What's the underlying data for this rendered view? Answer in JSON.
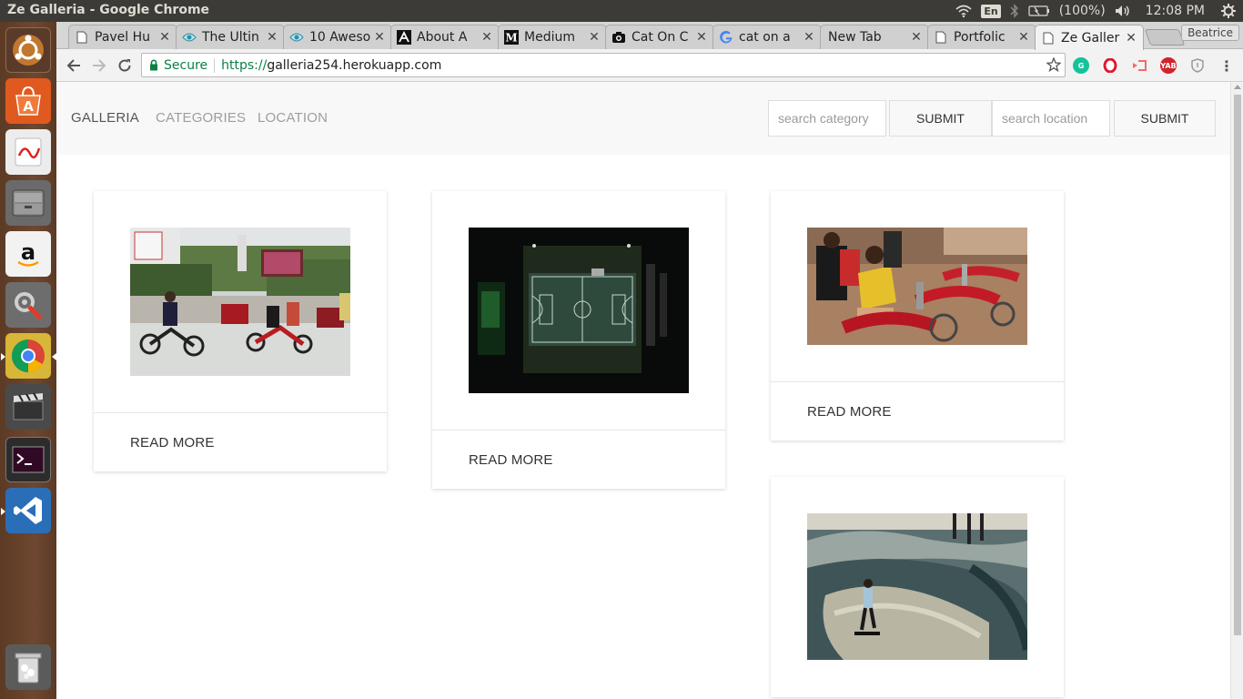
{
  "os": {
    "window_title": "Ze Galleria - Google Chrome",
    "keyboard_layout": "En",
    "battery": "(100%)",
    "clock": "12:08 PM"
  },
  "launcher": {
    "items": [
      {
        "name": "ubuntu-dash-icon"
      },
      {
        "name": "software-center-icon"
      },
      {
        "name": "document-viewer-icon"
      },
      {
        "name": "file-manager-icon"
      },
      {
        "name": "amazon-icon"
      },
      {
        "name": "system-settings-icon"
      },
      {
        "name": "chrome-icon"
      },
      {
        "name": "video-editor-icon"
      },
      {
        "name": "terminal-icon"
      },
      {
        "name": "vscode-icon"
      },
      {
        "name": "trash-icon"
      }
    ]
  },
  "browser": {
    "profile": "Beatrice",
    "tabs": [
      {
        "title": "Pavel Hu",
        "icon": "page-icon"
      },
      {
        "title": "The Ultin",
        "icon": "eye-icon"
      },
      {
        "title": "10 Aweso",
        "icon": "eye-icon"
      },
      {
        "title": "About A",
        "icon": "a-logo-icon"
      },
      {
        "title": "Medium",
        "icon": "medium-icon"
      },
      {
        "title": "Cat On C",
        "icon": "camera-icon"
      },
      {
        "title": "cat on a",
        "icon": "google-icon"
      },
      {
        "title": "New Tab",
        "icon": ""
      },
      {
        "title": "Portfolic",
        "icon": "page-icon"
      },
      {
        "title": "Ze Galler",
        "icon": "page-icon"
      }
    ],
    "address": {
      "secure_label": "Secure",
      "url_scheme": "https://",
      "url_rest": "galleria254.herokuapp.com"
    },
    "extensions": [
      "grammarly-icon",
      "opera-icon",
      "cast-icon",
      "yab-icon",
      "shield-icon"
    ]
  },
  "site": {
    "brand": "GALLERIA",
    "nav": [
      "CATEGORIES",
      "LOCATION"
    ],
    "search_category_placeholder": "search category",
    "search_location_placeholder": "search location",
    "submit_label": "SUBMIT",
    "cards": [
      {
        "photo": "boda-boda-motorcycles-street-photo",
        "action": "READ MORE"
      },
      {
        "photo": "aerial-basketball-court-night-photo",
        "action": "READ MORE"
      },
      {
        "photo": "motorcycle-riders-photo",
        "action": "READ MORE"
      },
      {
        "photo": "skatepark-photo",
        "action": "READ MORE"
      }
    ]
  },
  "colors": {
    "secure_green": "#0b8043",
    "navbar_bg": "#f8f8f8",
    "nav_link": "#9d9d9d",
    "ubuntu_orange": "#dd4814"
  }
}
